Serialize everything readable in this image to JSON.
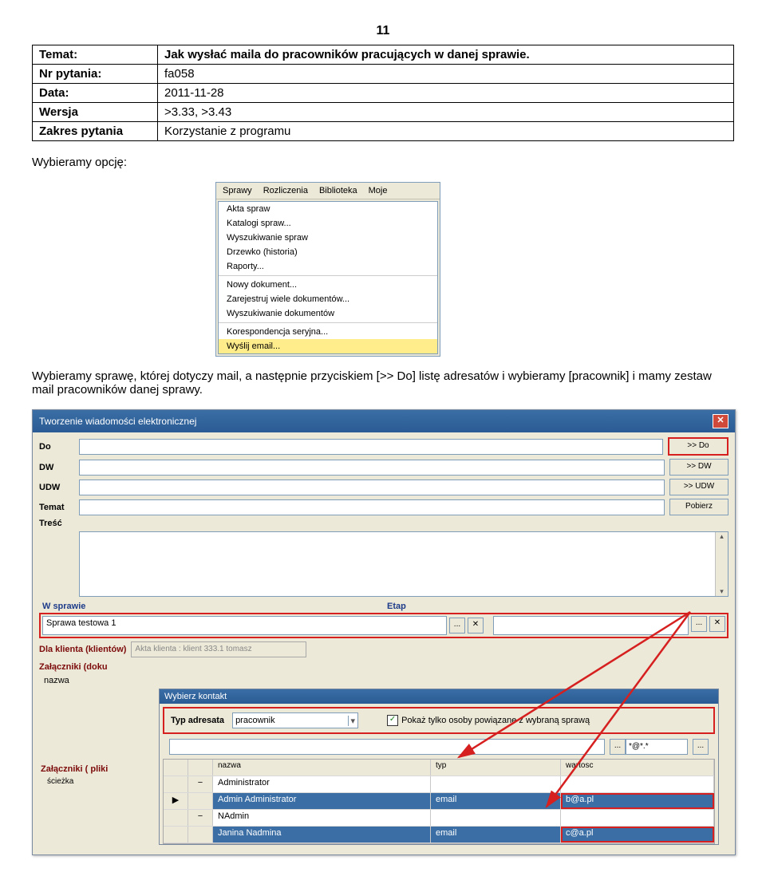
{
  "page_number": "11",
  "info": {
    "temat_label": "Temat:",
    "temat_value": "Jak wysłać maila do pracowników pracujących w danej sprawie.",
    "nr_label": "Nr pytania:",
    "nr_value": "fa058",
    "data_label": "Data:",
    "data_value": "2011-11-28",
    "wersja_label": "Wersja",
    "wersja_value": ">3.33, >3.43",
    "zakres_label": "Zakres pytania",
    "zakres_value": "Korzystanie z programu"
  },
  "body1": "Wybieramy opcję:",
  "body2": "Wybieramy sprawę, której dotyczy mail, a następnie przyciskiem [>> Do] listę adresatów i wybieramy [pracownik] i mamy zestaw mail pracowników danej sprawy.",
  "menu": {
    "bar": [
      "Sprawy",
      "Rozliczenia",
      "Biblioteka",
      "Moje"
    ],
    "items": [
      "Akta spraw",
      "Katalogi spraw...",
      "Wyszukiwanie spraw",
      "Drzewko (historia)",
      "Raporty...",
      "Nowy dokument...",
      "Zarejestruj wiele dokumentów...",
      "Wyszukiwanie dokumentów",
      "Korespondencja seryjna...",
      "Wyślij email..."
    ]
  },
  "dialog": {
    "title": "Tworzenie wiadomości elektronicznej",
    "close": "✕",
    "labels": {
      "do": "Do",
      "dw": "DW",
      "udw": "UDW",
      "temat": "Temat",
      "tresc": "Treść"
    },
    "buttons": {
      "do": ">> Do",
      "dw": ">> DW",
      "udw": ">> UDW",
      "pobierz": "Pobierz"
    },
    "sprawa_label": "W sprawie",
    "etap_label": "Etap",
    "sprawa_value": "Sprawa testowa 1",
    "dots": "...",
    "x": "✕",
    "dla_label": "Dla klienta (klientów)",
    "dla_value": "Akta klienta : klient 333.1 tomasz",
    "zal_doku": "Załączniki (doku",
    "nazwa_hdr": "nazwa",
    "zal_pliki": "Załączniki ( pliki",
    "sciezka": "ścieżka"
  },
  "contact": {
    "title": "Wybierz kontakt",
    "typ_label": "Typ adresata",
    "typ_value": "pracownik",
    "chk": "✓",
    "chk_label": "Pokaż tylko osoby powiązane z wybraną sprawą",
    "filter_short": "*@*.*",
    "hdr": {
      "name": "nazwa",
      "typ": "typ",
      "val": "wartosc"
    },
    "rows": [
      {
        "exp": "−",
        "name": "Administrator",
        "typ": "",
        "val": "",
        "blue": false
      },
      {
        "exp": "",
        "name": "Admin Administrator",
        "typ": "email",
        "val": "b@a.pl",
        "blue": true
      },
      {
        "exp": "−",
        "name": "NAdmin",
        "typ": "",
        "val": "",
        "blue": false
      },
      {
        "exp": "",
        "name": "Janina Nadmina",
        "typ": "email",
        "val": "c@a.pl",
        "blue": true
      }
    ]
  }
}
